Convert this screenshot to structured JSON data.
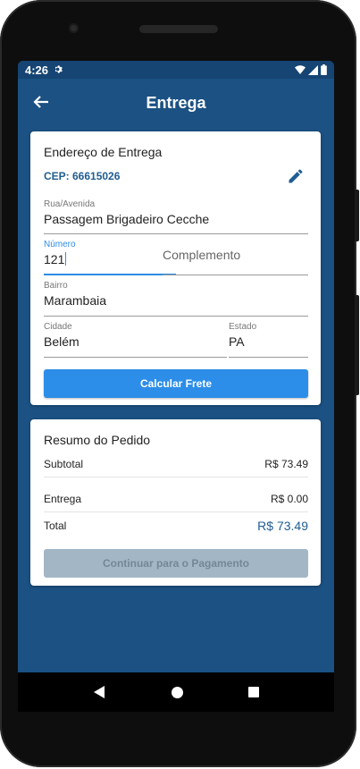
{
  "status": {
    "time": "4:26",
    "gear_icon": "gear-icon",
    "wifi_icon": "wifi-icon",
    "signal_icon": "signal-icon",
    "battery_icon": "battery-icon"
  },
  "appbar": {
    "title": "Entrega",
    "back_icon": "arrow-back-icon"
  },
  "address": {
    "title": "Endereço de Entrega",
    "cep": "CEP: 66615026",
    "edit_icon": "pencil-icon",
    "street_label": "Rua/Avenida",
    "street_value": "Passagem Brigadeiro Cecche",
    "number_label": "Número",
    "number_value": "121",
    "complement_placeholder": "Complemento",
    "district_label": "Bairro",
    "district_value": "Marambaia",
    "city_label": "Cidade",
    "city_value": "Belém",
    "state_label": "Estado",
    "state_value": "PA",
    "calc_button": "Calcular Frete"
  },
  "summary": {
    "title": "Resumo do Pedido",
    "subtotal_label": "Subtotal",
    "subtotal_value": "R$ 73.49",
    "delivery_label": "Entrega",
    "delivery_value": "R$ 0.00",
    "total_label": "Total",
    "total_value": "R$ 73.49",
    "continue_button": "Continuar para o Pagamento"
  },
  "colors": {
    "primary": "#1b5183",
    "accent": "#2c8ee8",
    "disabled": "#a3b6c6"
  }
}
